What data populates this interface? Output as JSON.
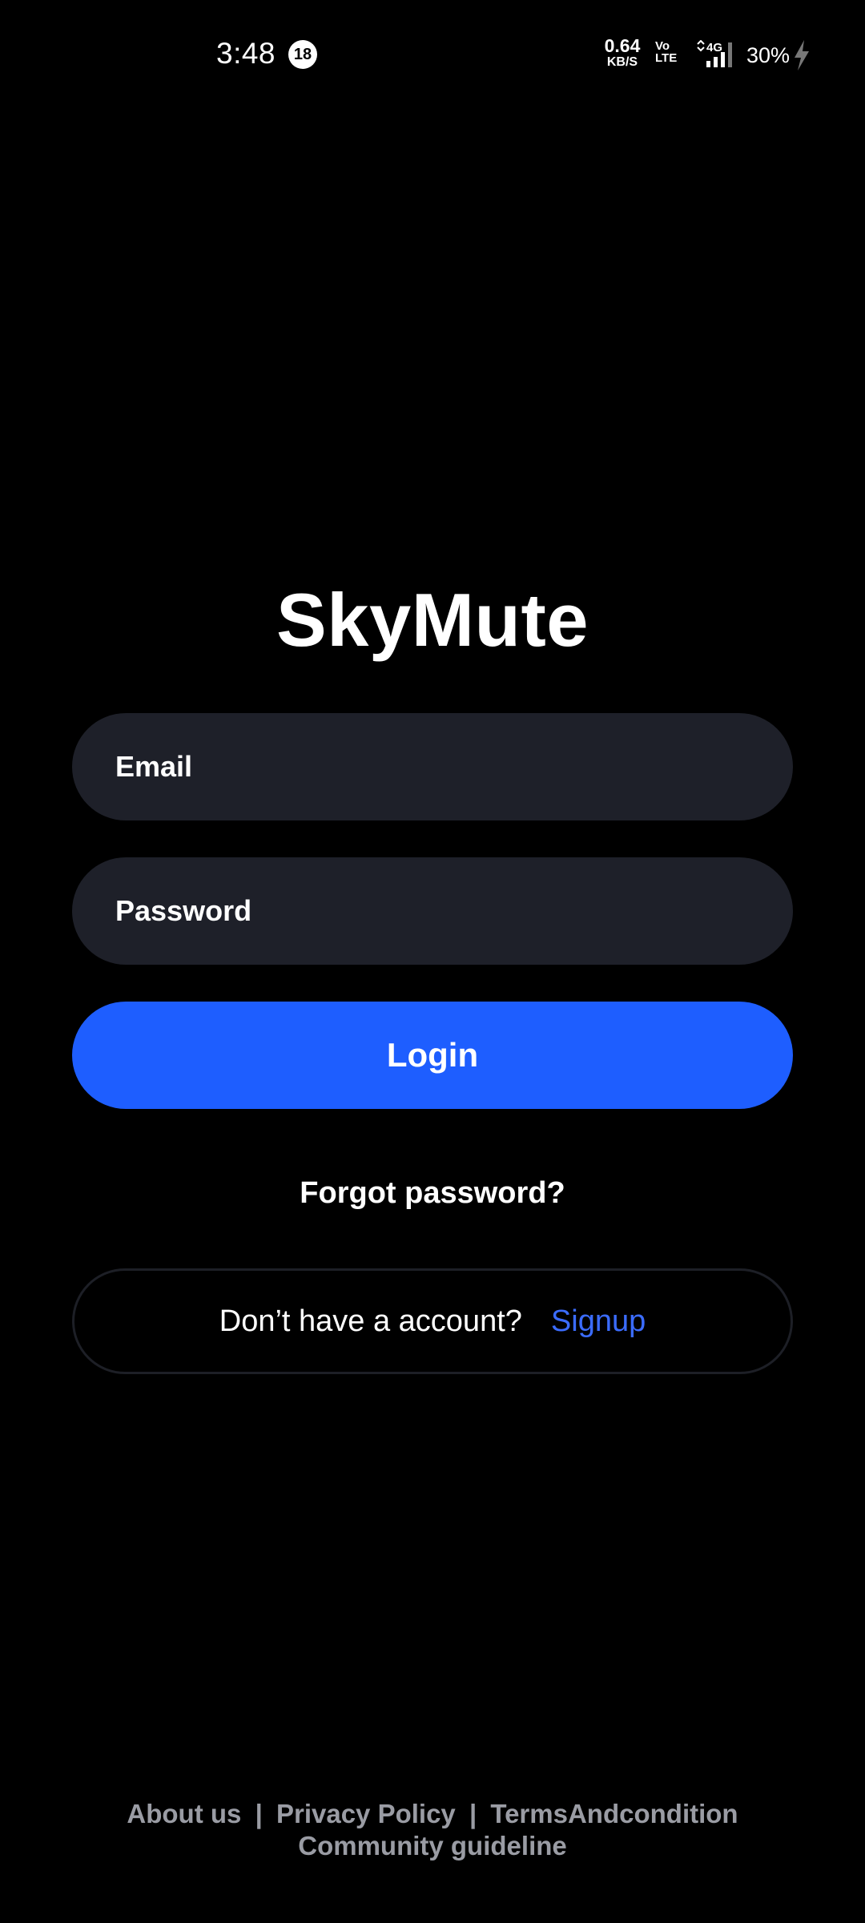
{
  "status_bar": {
    "time": "3:48",
    "notification_count": "18",
    "net_speed_value": "0.64",
    "net_speed_unit": "KB/S",
    "volte_line1": "Vo",
    "volte_line2": "LTE",
    "network_type": "4G",
    "battery": "30%"
  },
  "app": {
    "title": "SkyMute"
  },
  "form": {
    "email_placeholder": "Email",
    "password_placeholder": "Password",
    "login_label": "Login",
    "forgot_label": "Forgot password?"
  },
  "signup": {
    "prompt": "Don’t have a account?",
    "link": "Signup"
  },
  "footer": {
    "about": "About us",
    "privacy": "Privacy Policy",
    "terms": "TermsAndcondition",
    "separator": "|",
    "community": "Community guideline"
  },
  "colors": {
    "background": "#000000",
    "field": "#1e2029",
    "primary": "#1e5eff",
    "link": "#3b6cff",
    "footer_text": "#9a9ca4"
  },
  "icons": [
    "signal-icon",
    "charging-bolt-icon"
  ]
}
